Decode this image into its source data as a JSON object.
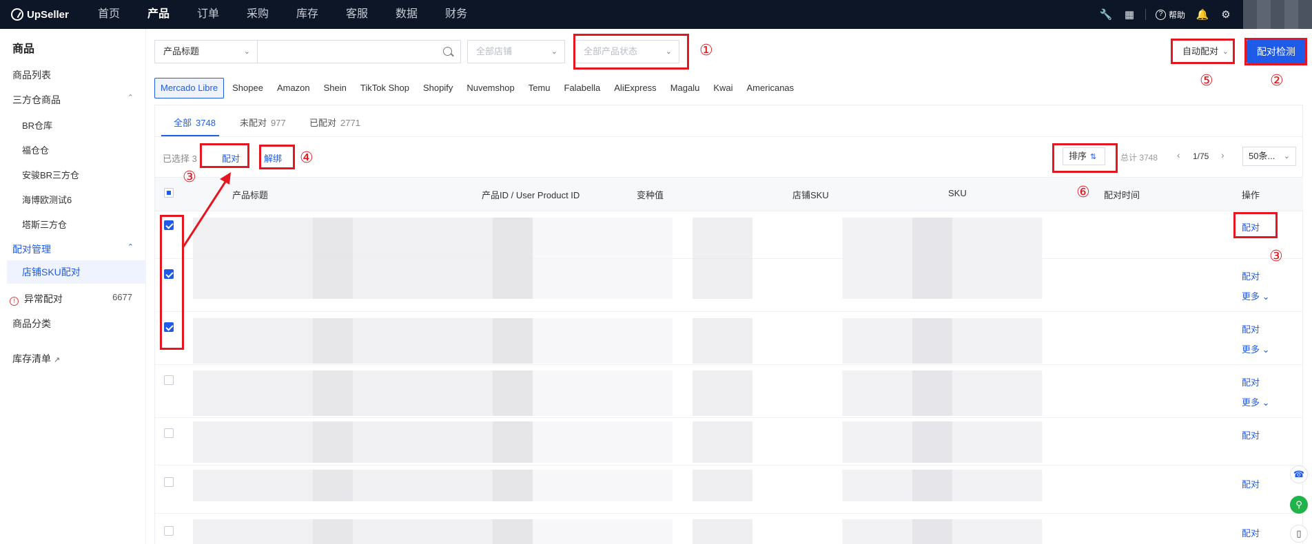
{
  "brand": "UpSeller",
  "nav": [
    "首页",
    "产品",
    "订单",
    "采购",
    "库存",
    "客服",
    "数据",
    "财务"
  ],
  "help_label": "帮助",
  "sidebar": {
    "title": "商品",
    "product_list": "商品列表",
    "third_party": "三方仓商品",
    "warehouses": [
      "BR仓库",
      "福仓仓",
      "安骏BR三方仓",
      "海博欧测试6",
      "塔斯三方仓"
    ],
    "match_mgmt": "配对管理",
    "store_sku_match": "店铺SKU配对",
    "abnormal": "异常配对",
    "abnormal_count": "6677",
    "category": "商品分类",
    "inventory": "库存清单"
  },
  "filters": {
    "title_select": "产品标题",
    "store_select": "全部店铺",
    "status_select": "全部产品状态",
    "auto_match": "自动配对",
    "match_check": "配对检测"
  },
  "marketplaces": [
    "Mercado Libre",
    "Shopee",
    "Amazon",
    "Shein",
    "TikTok Shop",
    "Shopify",
    "Nuvemshop",
    "Temu",
    "Falabella",
    "AliExpress",
    "Magalu",
    "Kwai",
    "Americanas"
  ],
  "tabs": [
    {
      "label": "全部",
      "count": "3748"
    },
    {
      "label": "未配对",
      "count": "977"
    },
    {
      "label": "已配对",
      "count": "2771"
    }
  ],
  "toolbar": {
    "selected": "已选择 3",
    "match": "配对",
    "unbind": "解绑",
    "sort": "排序",
    "total": "总计 3748",
    "page": "1/75",
    "page_size": "50条..."
  },
  "columns": [
    "产品标题",
    "产品ID / User Product ID",
    "变种值",
    "店铺SKU",
    "SKU",
    "配对时间",
    "操作"
  ],
  "row_actions": {
    "match": "配对",
    "more": "更多"
  },
  "annotations": [
    "①",
    "②",
    "③",
    "④",
    "⑤",
    "⑥",
    "③",
    "③"
  ],
  "colors": {
    "primary": "#1e5be8",
    "annotation": "#e5161f",
    "topbar": "#0d1626"
  }
}
